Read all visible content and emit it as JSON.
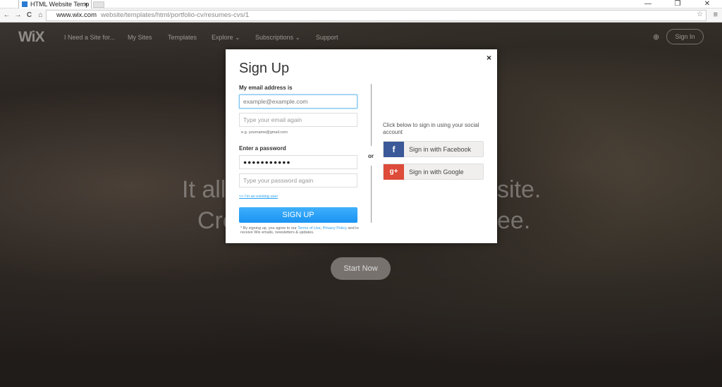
{
  "browser": {
    "tab_title": "HTML Website Temp",
    "tab_close": "×",
    "url_domain": "www.wix.com",
    "url_path": "website/templates/html/portfolio-cv/resumes-cvs/1",
    "controls": {
      "minimize": "—",
      "restore": "❐",
      "close": "✕"
    },
    "back": "←",
    "forward": "→",
    "reload": "C",
    "home": "⌂",
    "star": "☆",
    "menu": "≡"
  },
  "nav": {
    "logo": "WiX",
    "items": [
      "I Need a Site for...",
      "My Sites",
      "Templates",
      "Explore ⌄",
      "Subscriptions ⌄",
      "Support"
    ],
    "globe": "⊕",
    "sign_in": "Sign In"
  },
  "hero": {
    "line1_left": "It all",
    "line1_right": "site.",
    "line2_left": "Cre",
    "line2_right": "ee.",
    "cta": "Start Now"
  },
  "modal": {
    "close": "×",
    "title": "Sign Up",
    "email_label": "My email address is",
    "email_value": "example@example.com",
    "email_again_placeholder": "Type your email again",
    "email_hint": "e.g. yourname@gmail.com",
    "password_label": "Enter a password",
    "password_value": "●●●●●●●●●●●",
    "password_again_placeholder": "Type your password again",
    "existing_user": "<< I'm an existing user",
    "submit": "SIGN UP",
    "terms_prefix": "* By signing up, you agree to our ",
    "terms_link": "Terms of Use",
    "comma": ", ",
    "privacy_link": "Privacy Policy",
    "terms_suffix": " and to receive Wix emails, newsletters & updates.",
    "or": "or",
    "social_text": "Click below to sign in using your social account",
    "facebook": "Sign in with Facebook",
    "facebook_icon": "f",
    "google": "Sign in with Google",
    "google_icon": "g+",
    "colors": {
      "facebook": "#3b5998",
      "google": "#dd4b39",
      "primary": "#2aa3ef"
    }
  }
}
